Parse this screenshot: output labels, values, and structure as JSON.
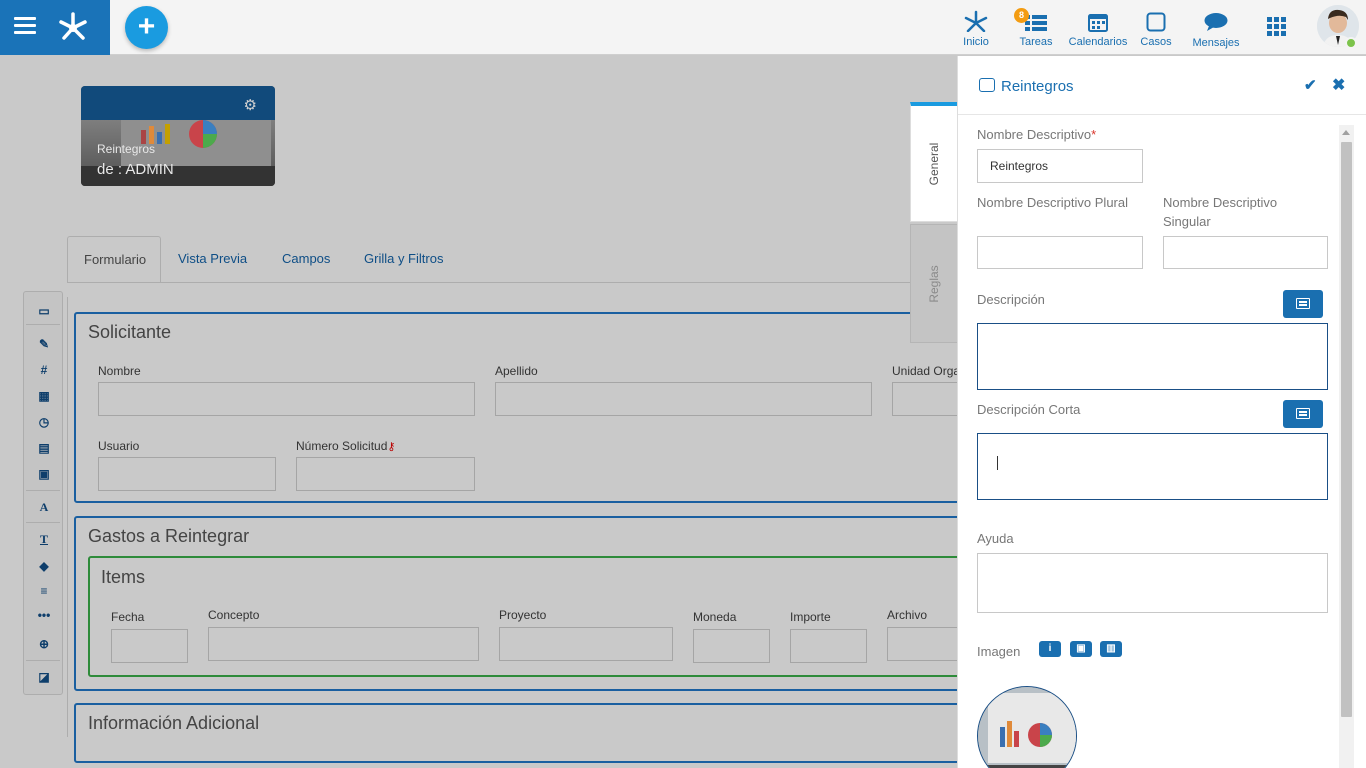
{
  "topbar": {
    "nav": [
      {
        "label": "Inicio",
        "icon": "network-icon"
      },
      {
        "label": "Tareas",
        "icon": "tasks-icon",
        "badge": "8"
      },
      {
        "label": "Calendarios",
        "icon": "calendar-icon"
      },
      {
        "label": "Casos",
        "icon": "cases-icon"
      },
      {
        "label": "Mensajes",
        "icon": "message-icon"
      }
    ],
    "apps_icon": "apps-grid-icon",
    "add_label": "+"
  },
  "card": {
    "title": "Reintegros",
    "subtitle": "de : ADMIN"
  },
  "tabs": [
    "Formulario",
    "Vista Previa",
    "Campos",
    "Grilla y Filtros"
  ],
  "form": {
    "solicitante": {
      "title": "Solicitante",
      "fields": [
        "Nombre",
        "Apellido",
        "Unidad Orga",
        "Usuario",
        "Número Solicitud"
      ]
    },
    "gastos": {
      "title": "Gastos a Reintegrar",
      "items_title": "Items",
      "columns": [
        "Fecha",
        "Concepto",
        "Proyecto",
        "Moneda",
        "Importe",
        "Archivo"
      ]
    },
    "info_title": "Información Adicional"
  },
  "sidetabs": [
    "General",
    "Reglas"
  ],
  "panel": {
    "title": "Reintegros",
    "nombre_label": "Nombre Descriptivo",
    "nombre_required": "*",
    "nombre_value": "Reintegros",
    "plural_label": "Nombre Descriptivo Plural",
    "singular_label": "Nombre Descriptivo Singular",
    "descripcion_label": "Descripción",
    "desc_corta_label": "Descripción Corta",
    "ayuda_label": "Ayuda",
    "imagen_label": "Imagen"
  },
  "colors": {
    "accent": "#1a6fb0",
    "brand": "#1a73b8",
    "add_button": "#1a9be0",
    "badge": "#f39c12",
    "online": "#7cc34b",
    "required": "#d9342b"
  }
}
